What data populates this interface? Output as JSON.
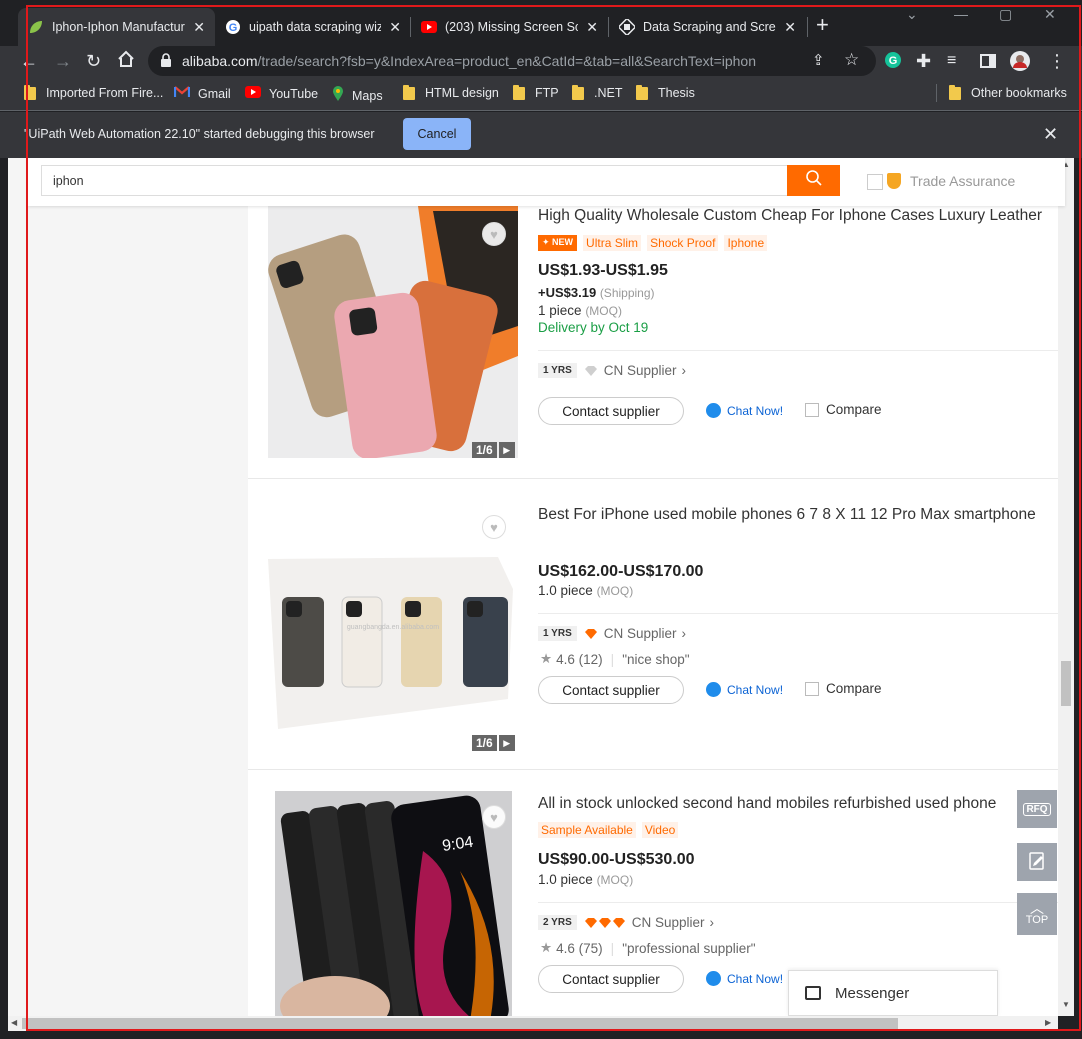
{
  "tabs": [
    {
      "title": "Iphon-Iphon Manufactur",
      "icon": "leaf-icon",
      "active": true
    },
    {
      "title": "uipath data scraping wiz",
      "icon": "google-icon",
      "active": false
    },
    {
      "title": "(203) Missing Screen Scr",
      "icon": "youtube-icon",
      "active": false
    },
    {
      "title": "Data Scraping and Screen",
      "icon": "uipath-icon",
      "active": false
    }
  ],
  "toolbar": {
    "url_host": "alibaba.com",
    "url_path": "/trade/search?fsb=y&IndexArea=product_en&CatId=&tab=all&SearchText=iphon"
  },
  "bookmarks": [
    {
      "label": "Imported From Fire...",
      "icon": "folder-icon"
    },
    {
      "label": "Gmail",
      "icon": "gmail-icon"
    },
    {
      "label": "YouTube",
      "icon": "youtube-icon"
    },
    {
      "label": "Maps",
      "icon": "maps-icon"
    },
    {
      "label": "HTML design",
      "icon": "folder-icon"
    },
    {
      "label": "FTP",
      "icon": "folder-icon"
    },
    {
      "label": ".NET",
      "icon": "folder-icon"
    },
    {
      "label": "Thesis",
      "icon": "folder-icon"
    }
  ],
  "other_bookmarks": "Other bookmarks",
  "debug": {
    "message": "\"UiPath Web Automation 22.10\" started debugging this browser",
    "cancel_label": "Cancel"
  },
  "search": {
    "query": "iphon",
    "trade_assurance_label": "Trade Assurance"
  },
  "products": [
    {
      "title": "High Quality Wholesale Custom Cheap For Iphone Cases Luxury Leather",
      "new_badge": "NEW",
      "tags": [
        "Ultra Slim",
        "Shock Proof",
        "Iphone"
      ],
      "price": "US$1.93-US$1.95",
      "shipping": "+US$3.19",
      "shipping_note": "(Shipping)",
      "moq": "1 piece",
      "moq_note": "(MOQ)",
      "delivery": "Delivery by Oct 19",
      "years": "1",
      "years_unit": "YRS",
      "supplier": "CN Supplier",
      "image_count": "1/6",
      "contact": "Contact supplier",
      "chat": "Chat Now!",
      "compare": "Compare"
    },
    {
      "title": "Best For iPhone used mobile phones 6 7 8 X 11 12 Pro Max smartphone",
      "price": "US$162.00-US$170.00",
      "moq": "1.0 piece",
      "moq_note": "(MOQ)",
      "years": "1",
      "years_unit": "YRS",
      "supplier": "CN Supplier",
      "rating": "4.6",
      "reviews": "(12)",
      "quote": "\"nice shop\"",
      "image_count": "1/6",
      "watermark": "guangbangda.en.alibaba.com",
      "contact": "Contact supplier",
      "chat": "Chat Now!",
      "compare": "Compare"
    },
    {
      "title": "All in stock unlocked second hand mobiles refurbished used phone",
      "tags": [
        "Sample Available",
        "Video"
      ],
      "price": "US$90.00-US$530.00",
      "moq": "1.0 piece",
      "moq_note": "(MOQ)",
      "years": "2",
      "years_unit": "YRS",
      "supplier": "CN Supplier",
      "rating": "4.6",
      "reviews": "(75)",
      "quote": "\"professional supplier\"",
      "phone_time": "9:04",
      "contact": "Contact supplier",
      "chat": "Chat Now!"
    }
  ],
  "floating": {
    "rfq": "RFQ",
    "top": "TOP",
    "messenger": "Messenger"
  },
  "colors": {
    "accent": "#ff6a00",
    "chrome_dark": "#202124",
    "chrome_mid": "#35363a",
    "delivery_green": "#1a9e45",
    "chat_blue": "#0b63d4"
  }
}
